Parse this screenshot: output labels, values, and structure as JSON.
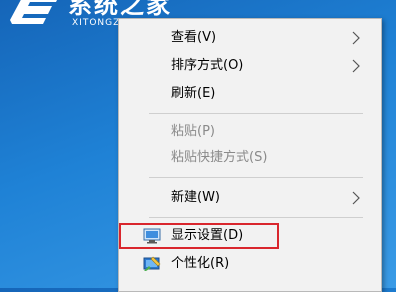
{
  "watermark": {
    "title": "系统之家",
    "subtitle": "XITONGZHIJIA"
  },
  "menu": {
    "items": [
      {
        "label": "查看(V)",
        "submenu": true
      },
      {
        "label": "排序方式(O)",
        "submenu": true
      },
      {
        "label": "刷新(E)"
      },
      {
        "label": "粘贴(P)",
        "disabled": true
      },
      {
        "label": "粘贴快捷方式(S)",
        "disabled": true
      },
      {
        "label": "新建(W)",
        "submenu": true
      },
      {
        "label": "显示设置(D)",
        "icon": "monitor-icon",
        "highlighted": true
      },
      {
        "label": "个性化(R)",
        "icon": "personalize-icon"
      }
    ]
  },
  "colors": {
    "highlight_border": "#d9262d",
    "menu_bg": "#f2f2f2",
    "desktop": "#1f82d6"
  }
}
